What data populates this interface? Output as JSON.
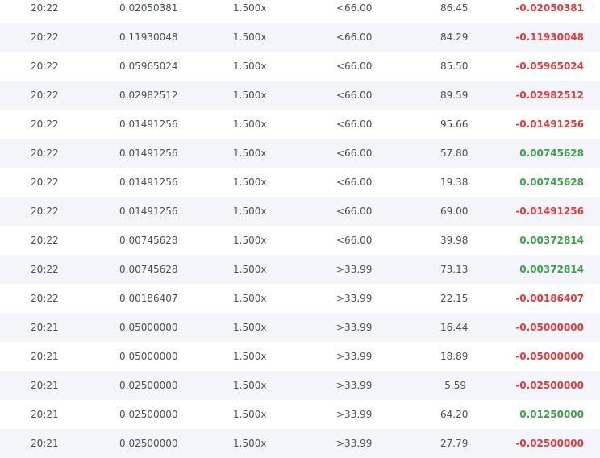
{
  "colors": {
    "loss": "#e03a3a",
    "win": "#3ca24a",
    "stripe": "#f3f5fa",
    "text": "#4a4f57"
  },
  "rows": [
    {
      "time": "20:22",
      "bet": "0.02050381",
      "payout": "1.500x",
      "target": "<66.00",
      "roll": "86.45",
      "profit": "-0.02050381",
      "result": "loss"
    },
    {
      "time": "20:22",
      "bet": "0.11930048",
      "payout": "1.500x",
      "target": "<66.00",
      "roll": "84.29",
      "profit": "-0.11930048",
      "result": "loss"
    },
    {
      "time": "20:22",
      "bet": "0.05965024",
      "payout": "1.500x",
      "target": "<66.00",
      "roll": "85.50",
      "profit": "-0.05965024",
      "result": "loss"
    },
    {
      "time": "20:22",
      "bet": "0.02982512",
      "payout": "1.500x",
      "target": "<66.00",
      "roll": "89.59",
      "profit": "-0.02982512",
      "result": "loss"
    },
    {
      "time": "20:22",
      "bet": "0.01491256",
      "payout": "1.500x",
      "target": "<66.00",
      "roll": "95.66",
      "profit": "-0.01491256",
      "result": "loss"
    },
    {
      "time": "20:22",
      "bet": "0.01491256",
      "payout": "1.500x",
      "target": "<66.00",
      "roll": "57.80",
      "profit": "0.00745628",
      "result": "win"
    },
    {
      "time": "20:22",
      "bet": "0.01491256",
      "payout": "1.500x",
      "target": "<66.00",
      "roll": "19.38",
      "profit": "0.00745628",
      "result": "win"
    },
    {
      "time": "20:22",
      "bet": "0.01491256",
      "payout": "1.500x",
      "target": "<66.00",
      "roll": "69.00",
      "profit": "-0.01491256",
      "result": "loss"
    },
    {
      "time": "20:22",
      "bet": "0.00745628",
      "payout": "1.500x",
      "target": "<66.00",
      "roll": "39.98",
      "profit": "0.00372814",
      "result": "win"
    },
    {
      "time": "20:22",
      "bet": "0.00745628",
      "payout": "1.500x",
      "target": ">33.99",
      "roll": "73.13",
      "profit": "0.00372814",
      "result": "win"
    },
    {
      "time": "20:22",
      "bet": "0.00186407",
      "payout": "1.500x",
      "target": ">33.99",
      "roll": "22.15",
      "profit": "-0.00186407",
      "result": "loss"
    },
    {
      "time": "20:21",
      "bet": "0.05000000",
      "payout": "1.500x",
      "target": ">33.99",
      "roll": "16.44",
      "profit": "-0.05000000",
      "result": "loss"
    },
    {
      "time": "20:21",
      "bet": "0.05000000",
      "payout": "1.500x",
      "target": ">33.99",
      "roll": "18.89",
      "profit": "-0.05000000",
      "result": "loss"
    },
    {
      "time": "20:21",
      "bet": "0.02500000",
      "payout": "1.500x",
      "target": ">33.99",
      "roll": "5.59",
      "profit": "-0.02500000",
      "result": "loss"
    },
    {
      "time": "20:21",
      "bet": "0.02500000",
      "payout": "1.500x",
      "target": ">33.99",
      "roll": "64.20",
      "profit": "0.01250000",
      "result": "win"
    },
    {
      "time": "20:21",
      "bet": "0.02500000",
      "payout": "1.500x",
      "target": ">33.99",
      "roll": "27.79",
      "profit": "-0.02500000",
      "result": "loss"
    }
  ]
}
